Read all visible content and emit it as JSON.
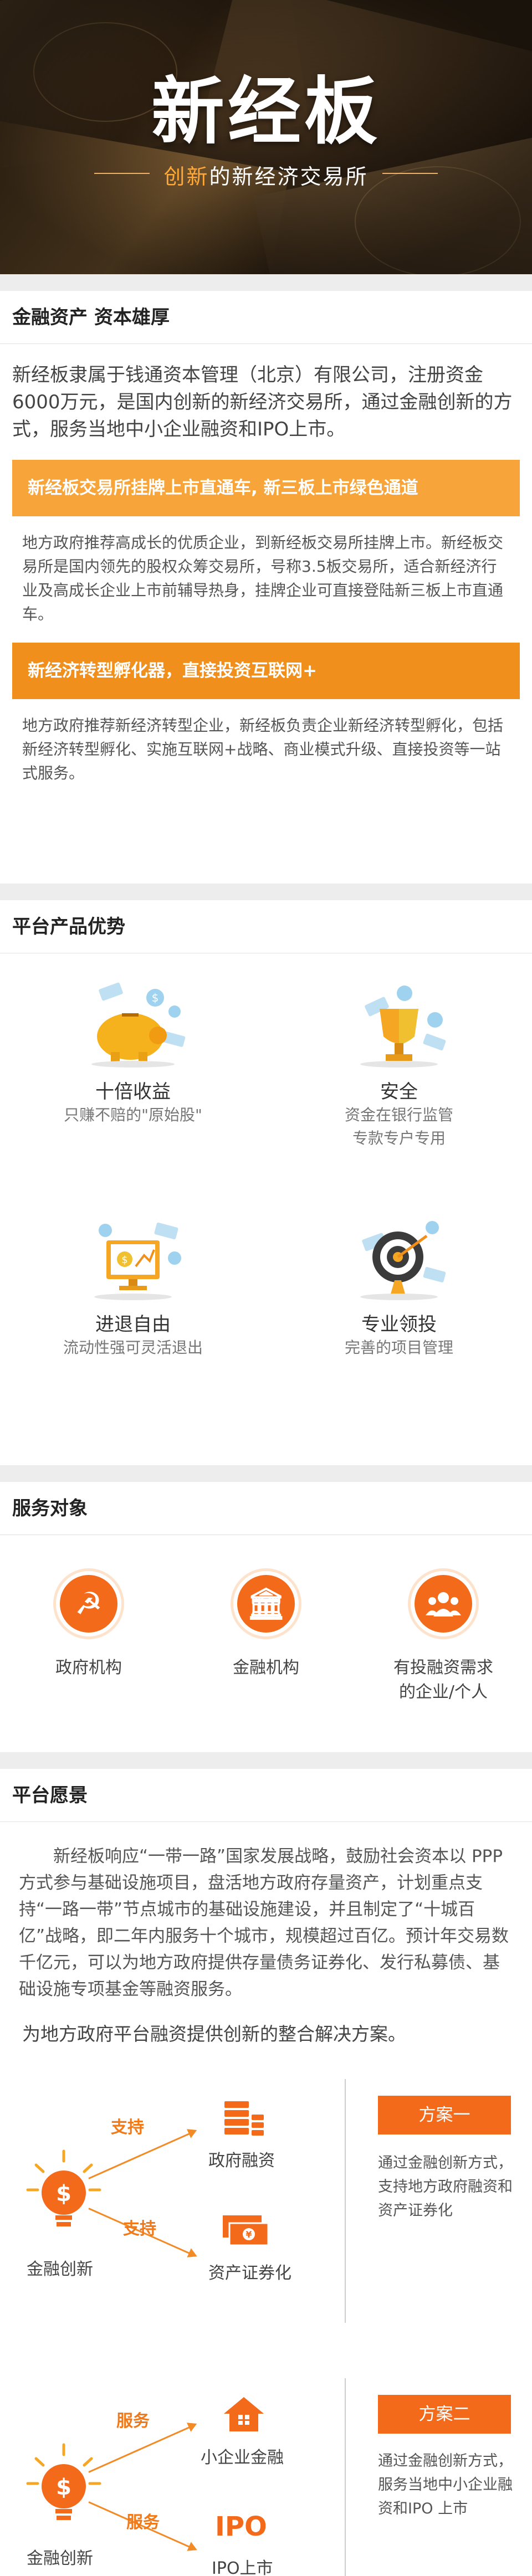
{
  "hero": {
    "title": "新经板",
    "subtitle_highlight": "创新",
    "subtitle_rest": "的新经济交易所"
  },
  "section1": {
    "heading": "金融资产 资本雄厚",
    "intro": "新经板隶属于钱通资本管理（北京）有限公司，注册资金6000万元，是国内创新的新经济交易所，通过金融创新的方式，服务当地中小企业融资和IPO上市。",
    "bar1": "新经板交易所挂牌上市直通车, 新三板上市绿色通道",
    "desc1": "地方政府推荐高成长的优质企业，到新经板交易所挂牌上市。新经板交易所是国内领先的股权众筹交易所，号称3.5板交易所，适合新经济行业及高成长企业上市前辅导热身，挂牌企业可直接登陆新三板上市直通车。",
    "bar2": "新经济转型孵化器，直接投资互联网+",
    "desc2": "地方政府推荐新经济转型企业，新经板负责企业新经济转型孵化，包括新经济转型孵化、实施互联网+战略、商业模式升级、直接投资等一站式服务。"
  },
  "section2": {
    "heading": "平台产品优势",
    "items": [
      {
        "title": "十倍收益",
        "sub1": "只赚不赔的\"原始股\"",
        "sub2": "",
        "icon": "piggy-bank-icon"
      },
      {
        "title": "安全",
        "sub1": "资金在银行监管",
        "sub2": "专款专户专用",
        "icon": "trophy-icon"
      },
      {
        "title": "进退自由",
        "sub1": "流动性强可灵活退出",
        "sub2": "",
        "icon": "monitor-icon"
      },
      {
        "title": "专业领投",
        "sub1": "完善的项目管理",
        "sub2": "",
        "icon": "target-icon"
      }
    ]
  },
  "section3": {
    "heading": "服务对象",
    "items": [
      {
        "label1": "政府机构",
        "label2": "",
        "icon": "hammer-sickle-icon"
      },
      {
        "label1": "金融机构",
        "label2": "",
        "icon": "bank-icon"
      },
      {
        "label1": "有投融资需求",
        "label2": "的企业/个人",
        "icon": "people-icon"
      }
    ]
  },
  "section4": {
    "heading": "平台愿景",
    "text": "新经板响应“一带一路”国家发展战略，鼓励社会资本以 PPP 方式参与基础设施项目，盘活地方政府存量资产，计划重点支持“一路一带”节点城市的基础设施建设，并且制定了“十城百亿”战略，即二年内服务十个城市，规模超过百亿。预计年交易数千亿元，可以为地方政府提供存量债务证券化、发行私募债、基础设施专项基金等融资服务。",
    "subtitle": "为地方政府平台融资提供创新的整合解决方案。",
    "plans": [
      {
        "left_label": "金融创新",
        "tag_top": "支持",
        "tag_bottom": "支持",
        "target_top": "政府融资",
        "target_bottom": "资产证券化",
        "scheme": "方案一",
        "scheme_desc": "通过金融创新方式，支持地方政府融资和资产证券化"
      },
      {
        "left_label": "金融创新",
        "tag_top": "服务",
        "tag_bottom": "服务",
        "target_top": "小企业金融",
        "target_bottom": "IPO上市",
        "bottom_icon_text": "IPO",
        "scheme": "方案二",
        "scheme_desc": "通过金融创新方式，服务当地中小企业融资和IPO 上市"
      }
    ]
  },
  "colors": {
    "accent": "#f36a1b",
    "bar_light": "#f7a53a",
    "bar_dark": "#f08f1c",
    "highlight": "#ffa83a"
  }
}
